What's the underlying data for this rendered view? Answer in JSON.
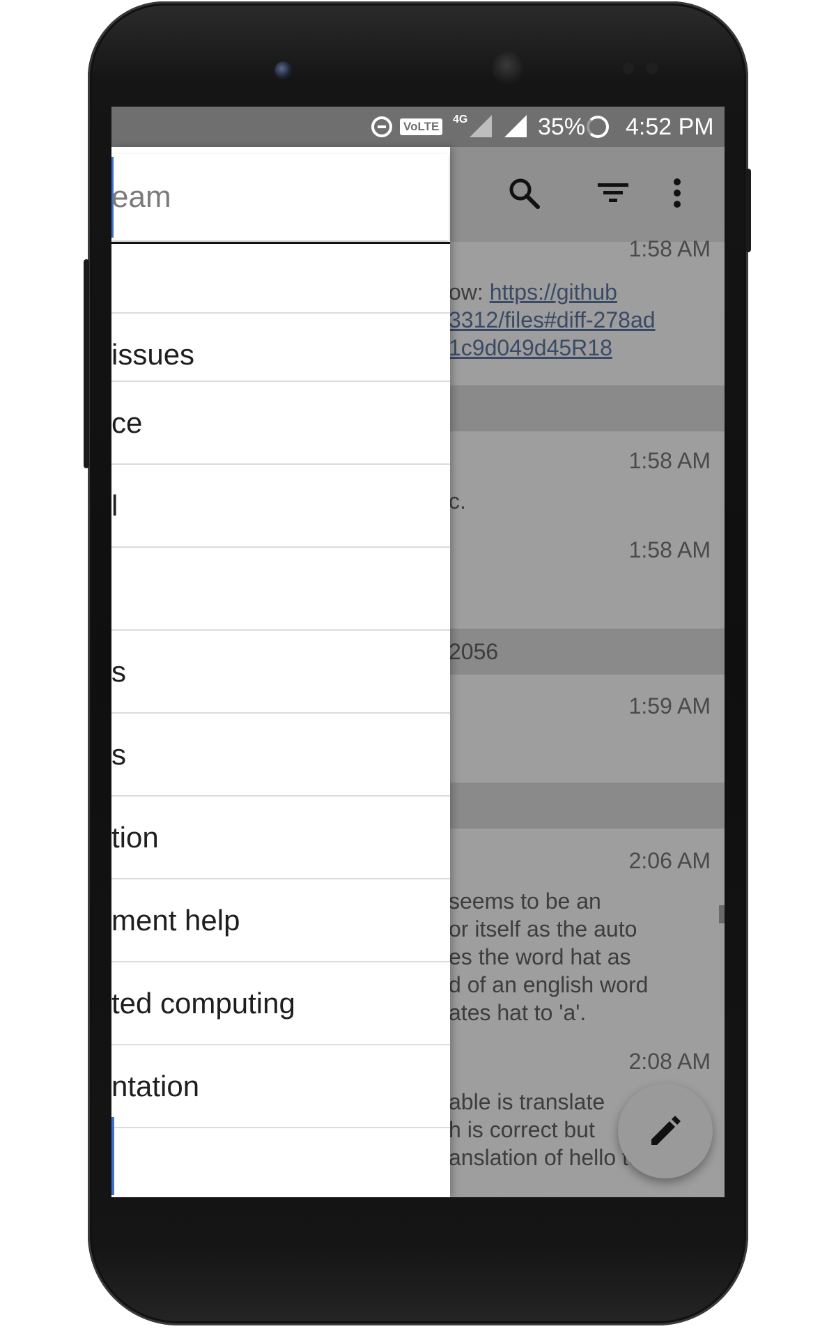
{
  "status_bar": {
    "volte": "VoLTE",
    "network": "4G",
    "battery": "35%",
    "time": "4:52 PM"
  },
  "app_bar": {
    "icons": [
      "search-icon",
      "filter-icon",
      "more-vert-icon"
    ]
  },
  "drawer": {
    "search_query": "eam",
    "streams": [
      "",
      "issues",
      "ce",
      "l",
      "",
      "s",
      "s",
      "tion",
      "ment help",
      "ted computing",
      "ntation",
      ""
    ]
  },
  "messages": {
    "m1_time": "1:58 AM",
    "m1_prefix": "ow: ",
    "m1_link_1": "https://github",
    "m1_link_2": "3312/files#diff-278ad",
    "m1_link_3": "1c9d049d45R18",
    "m2_time": "1:58 AM",
    "m2_text": "c.",
    "m3_time": "1:58 AM",
    "band_2_text": "2056",
    "m4_time": "1:59 AM",
    "m5_time": "2:06 AM",
    "m5_lines": [
      "seems to be an",
      "or itself as the auto",
      "es the word hat as",
      "d of an english word",
      "ates hat to 'a'."
    ],
    "m6_time": "2:08 AM",
    "m6_lines": [
      "able is translate",
      "h is correct but",
      "anslation of hello to"
    ]
  },
  "fab": {
    "icon": "pencil-icon"
  }
}
